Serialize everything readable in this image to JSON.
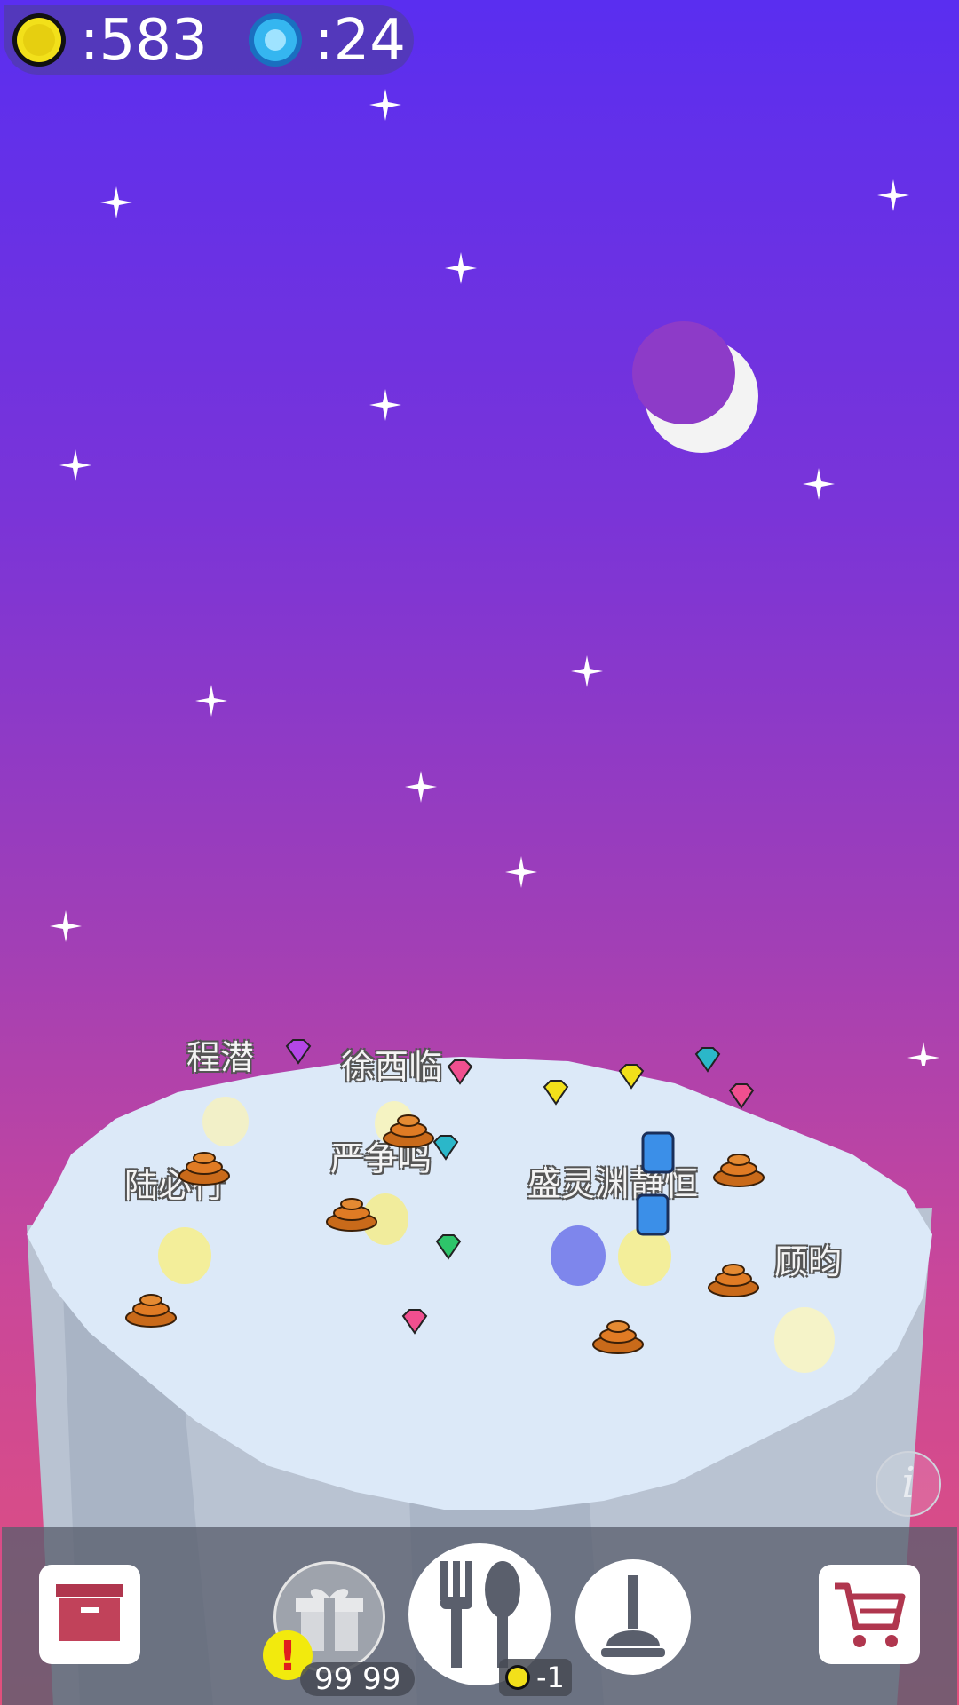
{
  "currency": {
    "coins": ":583",
    "gems": ":24",
    "coin_icon": "coin-icon",
    "gem_icon": "blue-gem-icon"
  },
  "creatures": [
    {
      "name": "程潜"
    },
    {
      "name": "徐西临"
    },
    {
      "name": "严争鸣"
    },
    {
      "name": "陆必行"
    },
    {
      "name": "盛灵渊"
    },
    {
      "name": "静恒"
    },
    {
      "name": "顾昀"
    }
  ],
  "toolbar": {
    "storage_icon": "storage-box-icon",
    "gift_icon": "gift-icon",
    "gift_alert": "!",
    "gift_count": "99 99",
    "feed_icon": "fork-spoon-icon",
    "feed_cost": "-1",
    "clean_icon": "plunger-icon",
    "shop_icon": "shopping-cart-icon"
  },
  "info_icon": "info-icon",
  "info_label": "i",
  "colors": {
    "sky_top": "#5a2ef0",
    "sky_bottom": "#e2507c",
    "platform_top": "#dce9f8",
    "coin": "#f2e01a",
    "gem": "#35b6f0"
  }
}
